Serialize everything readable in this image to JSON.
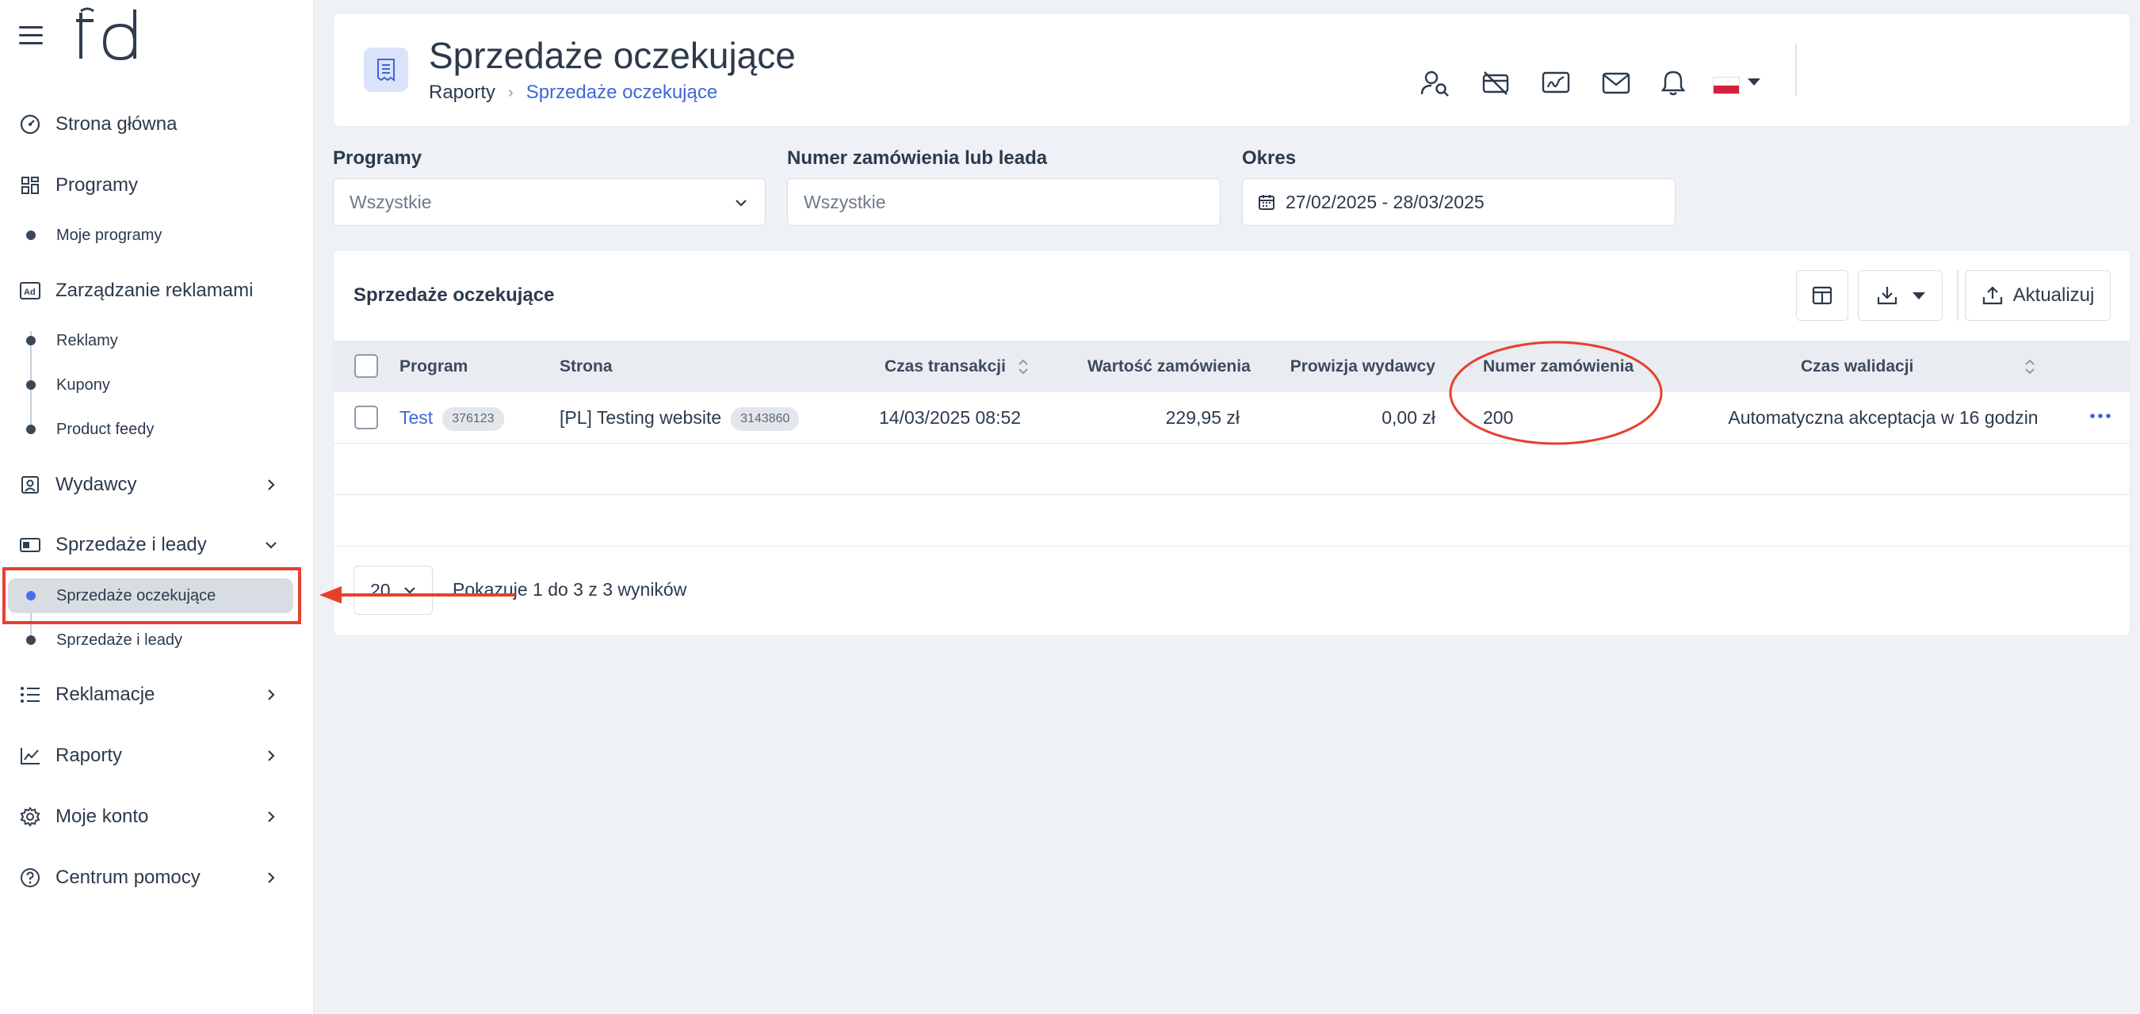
{
  "sidebar": {
    "logo": "td",
    "items": [
      {
        "label": "Strona główna"
      },
      {
        "label": "Programy"
      },
      {
        "label": "Zarządzanie reklamami"
      },
      {
        "label": "Wydawcy"
      },
      {
        "label": "Sprzedaże i leady"
      },
      {
        "label": "Reklamacje"
      },
      {
        "label": "Raporty"
      },
      {
        "label": "Moje konto"
      },
      {
        "label": "Centrum pomocy"
      }
    ],
    "subitems": {
      "programy": [
        {
          "label": "Moje programy"
        }
      ],
      "reklamy": [
        {
          "label": "Reklamy"
        },
        {
          "label": "Kupony"
        },
        {
          "label": "Product feedy"
        }
      ],
      "sprzedaze": [
        {
          "label": "Sprzedaże oczekujące",
          "active": true
        },
        {
          "label": "Sprzedaże i leady"
        }
      ]
    }
  },
  "header": {
    "title": "Sprzedaże oczekujące",
    "breadcrumb": [
      "Raporty",
      "Sprzedaże oczekujące"
    ],
    "icons": [
      "user-search-icon",
      "card-off-icon",
      "signature-icon",
      "mail-icon",
      "bell-icon",
      "flag-pl-icon"
    ]
  },
  "filters": {
    "programs": {
      "label": "Programy",
      "value": "Wszystkie"
    },
    "order": {
      "label": "Numer zamówienia lub leada",
      "placeholder": "Wszystkie"
    },
    "period": {
      "label": "Okres",
      "value": "27/02/2025 - 28/03/2025"
    }
  },
  "table": {
    "title": "Sprzedaże oczekujące",
    "update_label": "Aktualizuj",
    "columns": [
      "Program",
      "Strona",
      "Czas transakcji",
      "Wartość zamówienia",
      "Prowizja wydawcy",
      "Numer zamówienia",
      "Czas walidacji"
    ],
    "rows": [
      {
        "program": "Test",
        "program_id": "376123",
        "site": "[PL] Testing website",
        "site_id": "3143860",
        "time": "14/03/2025 08:52",
        "value": "229,95 zł",
        "commission": "0,00 zł",
        "order_number": "200",
        "validation": "Automatyczna akceptacja w 16 godzin"
      }
    ],
    "per_page": "20",
    "results_text": "Pokazuje 1 do 3 z 3 wyników"
  },
  "colors": {
    "accent": "#3f66d9",
    "annotation": "#e5402e",
    "sidebar_active": "#d8dde4"
  }
}
